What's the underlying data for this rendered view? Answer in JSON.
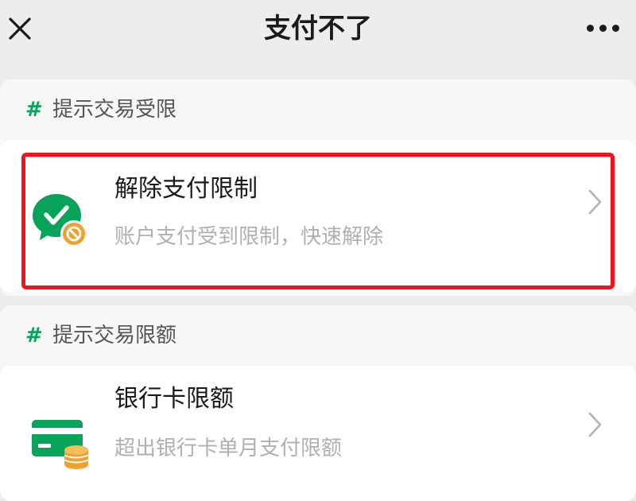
{
  "header": {
    "title": "支付不了",
    "close_icon": "close-icon",
    "more_icon": "more-icon"
  },
  "sections": [
    {
      "hash": "#",
      "title": "提示交易受限",
      "item": {
        "title": "解除支付限制",
        "subtitle": "账户支付受到限制，快速解除",
        "icon": "wechat-pay-restricted-icon"
      }
    },
    {
      "hash": "#",
      "title": "提示交易限额",
      "item": {
        "title": "银行卡限额",
        "subtitle": "超出银行卡单月支付限额",
        "icon": "bank-card-coins-icon"
      }
    }
  ],
  "colors": {
    "accent_green": "#07a35a",
    "highlight_red": "#f2141a",
    "badge_orange": "#f0a030",
    "background": "#ededed"
  }
}
